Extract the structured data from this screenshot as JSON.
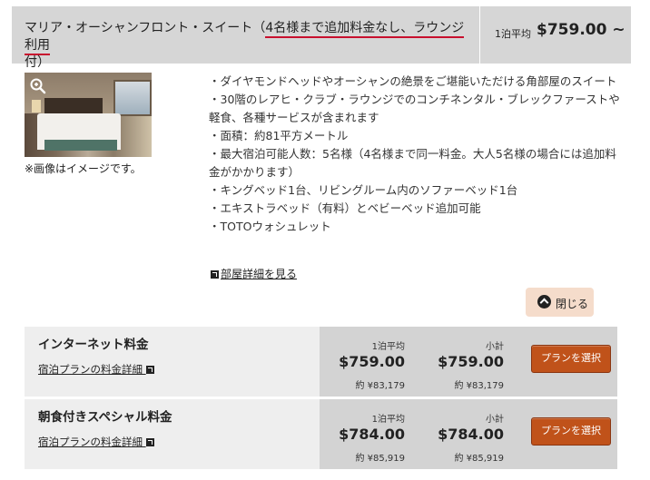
{
  "header": {
    "title_prefix": "マリア・オーシャンフロント・スイート（",
    "title_highlight": "4名様まで追加料金なし、ラウンジ利用",
    "title_suffix": "付）",
    "price_label": "1泊平均",
    "price": "$759.00 ~"
  },
  "photo_note": "※画像はイメージです。",
  "features": [
    "ダイヤモンドヘッドやオーシャンの絶景をご堪能いただける角部屋のスイート",
    "30階のレアヒ・クラブ・ラウンジでのコンチネンタル・ブレックファーストや軽食、各種サービスが含まれます",
    "面積：約81平方メートル",
    "最大宿泊可能人数：5名様（4名様まで同一料金。大人5名様の場合には追加料金がかかります）",
    "キングベッド1台、リビングルーム内のソファーベッド1台",
    "エキストラベッド（有料）とベビーベッド追加可能",
    "TOTOウォシュレット"
  ],
  "detail_link": "部屋詳細を見る",
  "close_label": "閉じる",
  "plans": [
    {
      "name": "インターネット料金",
      "detail_link": "宿泊プランの料金詳細",
      "avg_label": "1泊平均",
      "avg_price": "$759.00",
      "avg_yen": "約 ¥83,179",
      "sub_label": "小計",
      "sub_price": "$759.00",
      "sub_yen": "約 ¥83,179",
      "button": "プランを選択"
    },
    {
      "name": "朝食付きスペシャル料金",
      "detail_link": "宿泊プランの料金詳細",
      "avg_label": "1泊平均",
      "avg_price": "$784.00",
      "avg_yen": "約 ¥85,919",
      "sub_label": "小計",
      "sub_price": "$784.00",
      "sub_yen": "約 ¥85,919",
      "button": "プランを選択"
    }
  ],
  "colors": {
    "highlight_underline": "#c8102e",
    "select_button": "#c0521a",
    "close_button_bg": "#f5dccb"
  },
  "icons": {
    "zoom": "magnifier-icon",
    "external": "external-link-icon",
    "close": "chevron-up-circle-icon"
  }
}
